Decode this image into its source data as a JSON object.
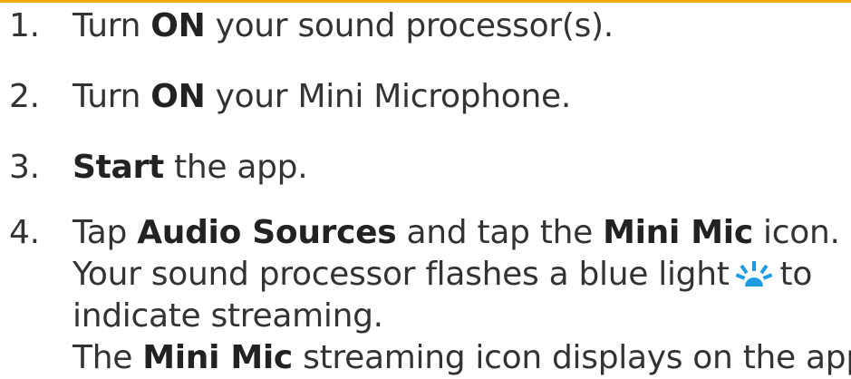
{
  "accent_color": "#f5a800",
  "icon_color": "#1f9be6",
  "steps": [
    {
      "number": "1.",
      "parts": [
        "Turn ",
        "ON",
        " your sound processor(s)."
      ]
    },
    {
      "number": "2.",
      "parts": [
        "Turn ",
        "ON",
        " your Mini Microphone."
      ]
    },
    {
      "number": "3.",
      "parts": [
        "Start",
        " the app."
      ]
    },
    {
      "number": "4.",
      "line1": [
        "Tap ",
        "Audio Sources",
        " and tap the ",
        "Mini Mic",
        " icon."
      ],
      "line2": [
        "Your sound processor flashes a blue light",
        "to"
      ],
      "line3": "indicate streaming.",
      "line4": [
        "The ",
        "Mini Mic",
        " streaming icon displays on the app."
      ]
    }
  ],
  "icons": {
    "blue_light": "blue-light-flash-icon"
  }
}
